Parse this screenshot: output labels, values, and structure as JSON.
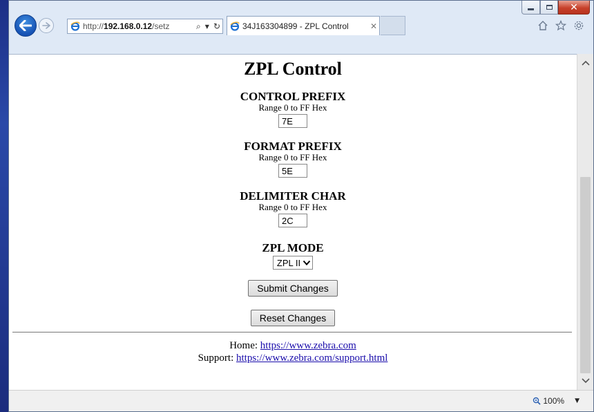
{
  "browser": {
    "address_url_prefix": "http://",
    "address_url_host": "192.168.0.12",
    "address_url_rest": "/setz",
    "tab_title": "34J163304899 - ZPL Control",
    "zoom_level": "100%"
  },
  "page": {
    "title": "ZPL Control",
    "fields": [
      {
        "label": "CONTROL PREFIX",
        "range": "Range 0 to FF Hex",
        "value": "7E"
      },
      {
        "label": "FORMAT PREFIX",
        "range": "Range 0 to FF Hex",
        "value": "5E"
      },
      {
        "label": "DELIMITER CHAR",
        "range": "Range 0 to FF Hex",
        "value": "2C"
      }
    ],
    "mode": {
      "label": "ZPL MODE",
      "selected": "ZPL II"
    },
    "submit_label": "Submit Changes",
    "reset_label": "Reset Changes",
    "footer": {
      "home_label": "Home:",
      "home_link": "https://www.zebra.com",
      "support_label": "Support:",
      "support_link": "https://www.zebra.com/support.html"
    }
  },
  "colors": {
    "desktop": "#1f3a8f",
    "frame": "#dfe9f6",
    "link": "#1a0dab",
    "close_button": "#c7412b"
  },
  "icons": [
    "minimize-icon",
    "maximize-icon",
    "close-icon",
    "back-arrow-icon",
    "forward-arrow-icon",
    "ie-logo-icon",
    "search-icon",
    "dropdown-icon",
    "refresh-icon",
    "tab-close-icon",
    "home-icon",
    "star-icon",
    "gear-icon",
    "scroll-up-icon",
    "scroll-down-icon",
    "zoom-icon",
    "chevron-down-icon"
  ]
}
